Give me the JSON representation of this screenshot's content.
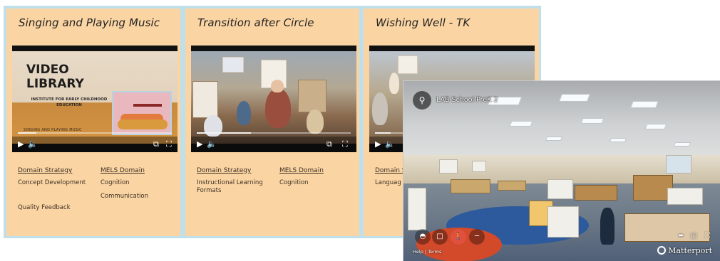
{
  "cards": [
    {
      "title": "Singing and Playing Music",
      "video": {
        "thumb_title_line1": "VIDEO",
        "thumb_title_line2": "LIBRARY",
        "thumb_subtitle": "INSTITUTE FOR EARLY CHILDHOOD EDUCATION",
        "thumb_topic": "SINGING AND PLAYING MUSIC",
        "progress": 0.12
      },
      "strategy_header": "Domain Strategy",
      "strategy_values": [
        "Concept Development",
        "Quality Feedback"
      ],
      "mels_header": "MELS Domain",
      "mels_values": [
        "Cognition",
        "Communication"
      ]
    },
    {
      "title": "Transition after Circle",
      "video": {
        "progress": 0.35
      },
      "strategy_header": "Domain Strategy",
      "strategy_values": [
        "Instructional Learning Formats"
      ],
      "mels_header": "MELS Domain",
      "mels_values": [
        "Cognition"
      ]
    },
    {
      "title": "Wishing Well - TK",
      "video": {
        "progress": 0.1
      },
      "strategy_header": "Domain S",
      "strategy_values": [
        "Languag"
      ]
    }
  ],
  "video_controls": {
    "play_icon": "play-icon",
    "volume_icon": "volume-icon",
    "pip_icon": "picture-in-picture-icon",
    "fullscreen_icon": "fullscreen-icon"
  },
  "matterport": {
    "title": "LAB School PreK 2",
    "footer_help": "Help",
    "footer_sep": "|",
    "footer_terms": "Terms",
    "logo": "Matterport",
    "accent": "#e0503f"
  }
}
